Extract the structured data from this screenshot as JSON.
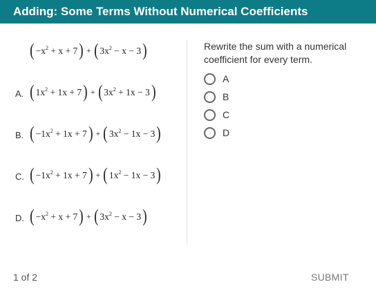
{
  "header": {
    "title": "Adding: Some Terms Without Numerical Coefficients"
  },
  "problem": {
    "main": {
      "p1": [
        "−x",
        "2",
        "+ x + 7"
      ],
      "p2": [
        "3x",
        "2",
        "− x − 3"
      ]
    },
    "options": [
      {
        "letter": "A.",
        "p1": [
          "1x",
          "2",
          "+ 1x + 7"
        ],
        "p2": [
          "3x",
          "2",
          "+ 1x − 3"
        ]
      },
      {
        "letter": "B.",
        "p1": [
          "−1x",
          "2",
          "+ 1x + 7"
        ],
        "p2": [
          "3x",
          "2",
          "− 1x − 3"
        ]
      },
      {
        "letter": "C.",
        "p1": [
          "−1x",
          "2",
          "+ 1x + 7"
        ],
        "p2": [
          "1x",
          "2",
          "− 1x − 3"
        ]
      },
      {
        "letter": "D.",
        "p1": [
          "−x",
          "2",
          "+ x + 7"
        ],
        "p2": [
          "3x",
          "2",
          "− x − 3"
        ]
      }
    ],
    "plus": "+"
  },
  "question": {
    "prompt": "Rewrite the sum with a numerical coefficient for every term.",
    "choices": [
      "A",
      "B",
      "C",
      "D"
    ]
  },
  "footer": {
    "page_indicator": "1 of 2",
    "submit_label": "SUBMIT"
  }
}
